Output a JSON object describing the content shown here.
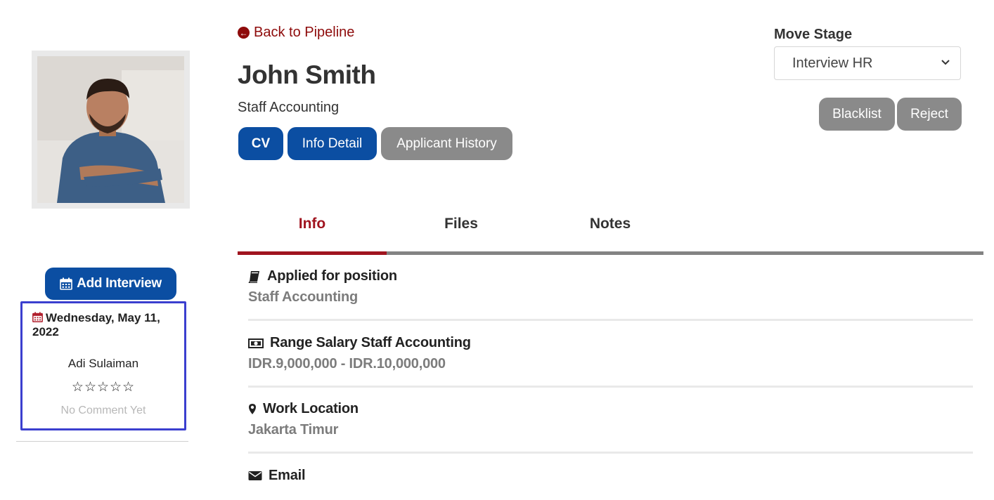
{
  "nav": {
    "back_label": "Back to Pipeline"
  },
  "candidate": {
    "name": "John Smith",
    "position": "Staff Accounting"
  },
  "action_buttons": {
    "cv": "CV",
    "info_detail": "Info Detail",
    "applicant_history": "Applicant History"
  },
  "move_stage": {
    "label": "Move Stage",
    "selected": "Interview HR",
    "blacklist_label": "Blacklist",
    "reject_label": "Reject"
  },
  "interview": {
    "add_label": "Add Interview",
    "date": "Wednesday, May 11, 2022",
    "interviewer": "Adi Sulaiman",
    "rating_display": "☆☆☆☆☆",
    "rating": 0,
    "rating_max": 5,
    "comment": "No Comment Yet"
  },
  "tabs": [
    {
      "label": "Info",
      "active": true
    },
    {
      "label": "Files",
      "active": false
    },
    {
      "label": "Notes",
      "active": false
    }
  ],
  "info_fields": [
    {
      "icon": "book-icon",
      "label": "Applied for position",
      "value": "Staff Accounting"
    },
    {
      "icon": "money-icon",
      "label": "Range Salary Staff Accounting",
      "value": "IDR.9,000,000 - IDR.10,000,000"
    },
    {
      "icon": "map-marker-icon",
      "label": "Work Location",
      "value": "Jakarta Timur"
    },
    {
      "icon": "envelope-icon",
      "label": "Email",
      "value": ""
    }
  ],
  "colors": {
    "primary_blue": "#0b4ea2",
    "accent_red": "#a0141f",
    "link_red": "#8e0b0b",
    "neutral_button": "#8a8a8a",
    "highlight_border": "#3b3fcf"
  }
}
